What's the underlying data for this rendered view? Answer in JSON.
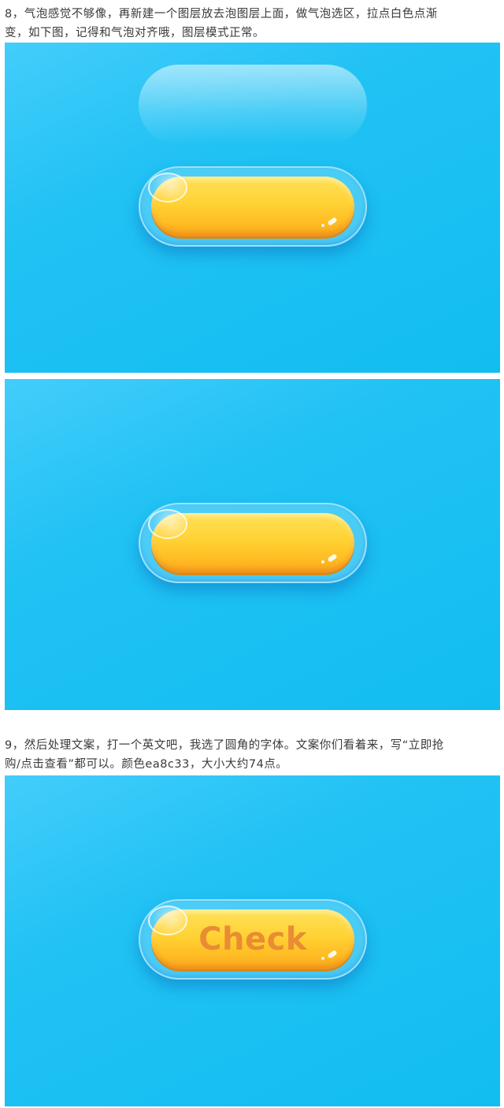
{
  "step8": {
    "lines": [
      "8，气泡感觉不够像，再新建一个图层放去泡图层上面，做气泡选区，拉点白色点渐",
      "变，如下图，记得和气泡对齐哦，图层模式正常。"
    ]
  },
  "step9": {
    "lines": [
      "9，然后处理文案，打一个英文吧，我选了圆角的字体。文案你们看着来，写“立即抢",
      "购/点击查看”都可以。颜色ea8c33，大小大约74点。"
    ]
  },
  "button": {
    "label": "Check",
    "text_color": "#ea8c33",
    "pill_color": "#ffd234",
    "background_color": "#12bdf0"
  }
}
